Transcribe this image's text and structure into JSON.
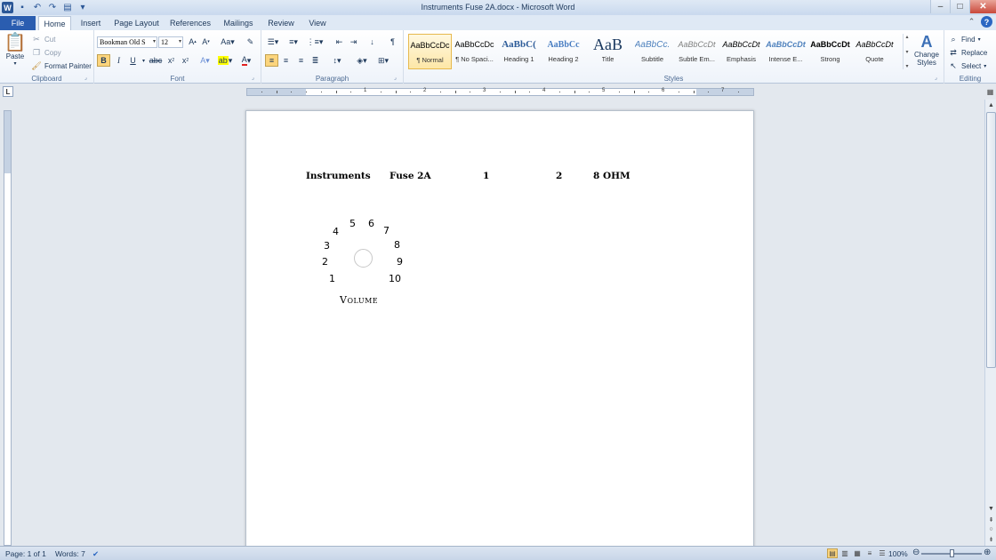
{
  "window": {
    "title": "Instruments      Fuse 2A.docx - Microsoft Word",
    "controls": {
      "minimize": "–",
      "maximize": "□",
      "close": "✕"
    }
  },
  "tabs": [
    {
      "label": "File"
    },
    {
      "label": "Home",
      "active": true
    },
    {
      "label": "Insert"
    },
    {
      "label": "Page Layout"
    },
    {
      "label": "References"
    },
    {
      "label": "Mailings"
    },
    {
      "label": "Review"
    },
    {
      "label": "View"
    }
  ],
  "ribbon": {
    "clipboard": {
      "label": "Clipboard",
      "paste": "Paste",
      "cut": "Cut",
      "copy": "Copy",
      "format_painter": "Format Painter"
    },
    "font": {
      "label": "Font",
      "font_name": "Bookman Old S",
      "font_size": "12"
    },
    "paragraph": {
      "label": "Paragraph"
    },
    "styles": {
      "label": "Styles",
      "items": [
        {
          "sample": "AaBbCcDc",
          "name": "¶ Normal",
          "active": true
        },
        {
          "sample": "AaBbCcDc",
          "name": "¶ No Spaci..."
        },
        {
          "sample": "AaBbC(",
          "name": "Heading 1"
        },
        {
          "sample": "AaBbCc",
          "name": "Heading 2"
        },
        {
          "sample": "AaB",
          "name": "Title"
        },
        {
          "sample": "AaBbCc.",
          "name": "Subtitle"
        },
        {
          "sample": "AaBbCcDt",
          "name": "Subtle Em..."
        },
        {
          "sample": "AaBbCcDt",
          "name": "Emphasis"
        },
        {
          "sample": "AaBbCcDt",
          "name": "Intense E..."
        },
        {
          "sample": "AaBbCcDt",
          "name": "Strong"
        },
        {
          "sample": "AaBbCcDt",
          "name": "Quote"
        }
      ],
      "change_styles": "Change Styles"
    },
    "editing": {
      "label": "Editing",
      "find": "Find",
      "replace": "Replace",
      "select": "Select"
    }
  },
  "document": {
    "line": {
      "instruments": "Instruments",
      "fuse": "Fuse 2A",
      "col1": "1",
      "col2": "2",
      "ohm": "8 OHM"
    },
    "dial_numbers": [
      "1",
      "2",
      "3",
      "4",
      "5",
      "6",
      "7",
      "8",
      "9",
      "10"
    ],
    "volume_label": "Volume"
  },
  "statusbar": {
    "page": "Page: 1 of 1",
    "words": "Words: 7",
    "zoom": "100%"
  },
  "colors": {
    "file_tab": "#2a5db0",
    "active_highlight": "#fcd57d",
    "ribbon_text": "#1e395b"
  }
}
